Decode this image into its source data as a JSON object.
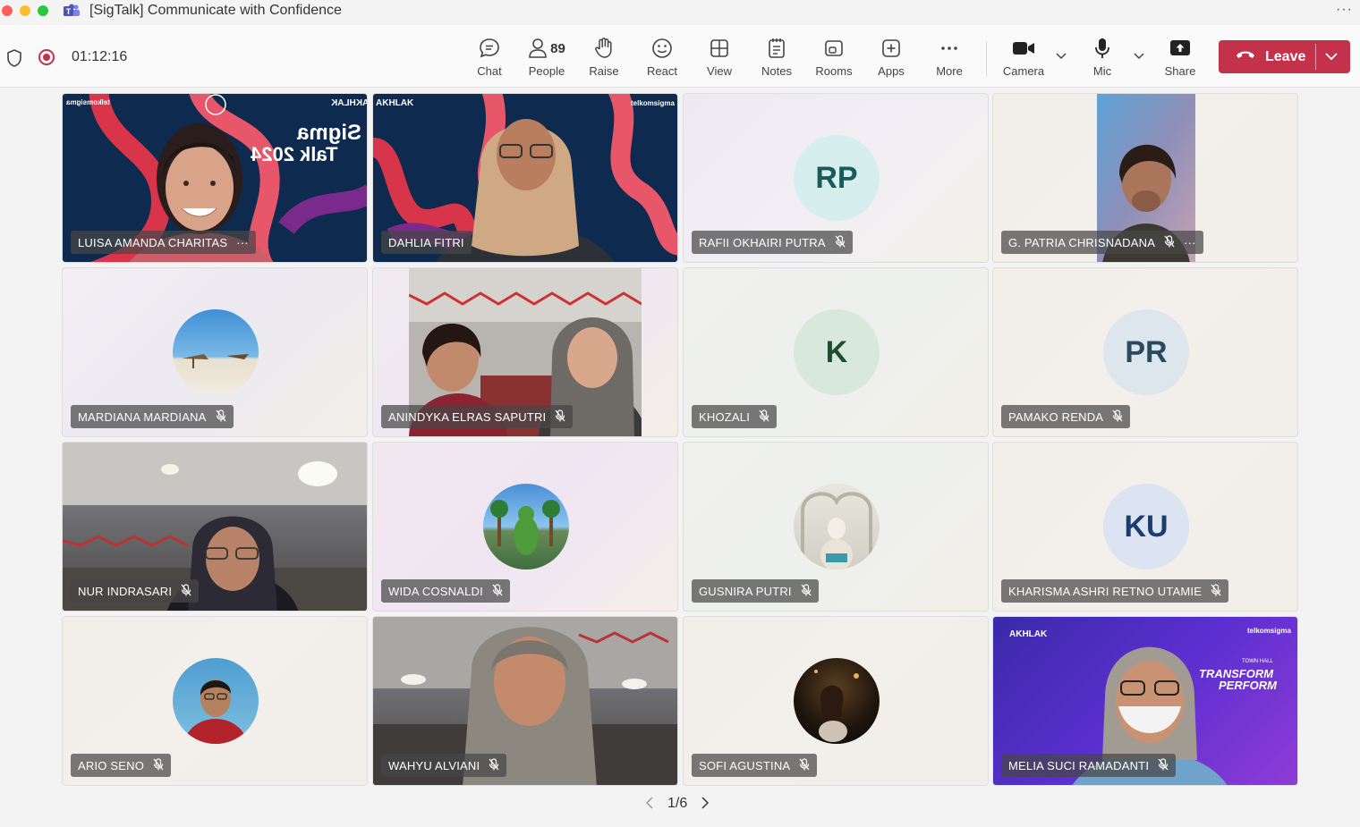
{
  "window": {
    "title": "[SigTalk] Communicate with Confidence"
  },
  "toolbar": {
    "timer": "01:12:16",
    "chat_label": "Chat",
    "people_label": "People",
    "people_count": "89",
    "raise_label": "Raise",
    "react_label": "React",
    "view_label": "View",
    "notes_label": "Notes",
    "rooms_label": "Rooms",
    "apps_label": "Apps",
    "more_label": "More",
    "camera_label": "Camera",
    "mic_label": "Mic",
    "share_label": "Share",
    "leave_label": "Leave"
  },
  "colors": {
    "leave": "#c4314b",
    "recording": "#c4314b"
  },
  "participants": [
    {
      "name": "LUISA AMANDA CHARITAS",
      "type": "video",
      "muted": false,
      "more": true
    },
    {
      "name": "DAHLIA FITRI",
      "type": "video",
      "muted": false
    },
    {
      "name": "RAFII OKHAIRI PUTRA",
      "type": "initials",
      "initials": "RP",
      "muted": true
    },
    {
      "name": "G. PATRIA CHRISNADANA",
      "type": "video",
      "muted": true,
      "more": true
    },
    {
      "name": "MARDIANA MARDIANA",
      "type": "photo",
      "muted": true
    },
    {
      "name": "ANINDYKA ELRAS SAPUTRI",
      "type": "video",
      "muted": true
    },
    {
      "name": "KHOZALI",
      "type": "initials",
      "initials": "K",
      "muted": true
    },
    {
      "name": "PAMAKO RENDA",
      "type": "initials",
      "initials": "PR",
      "muted": true
    },
    {
      "name": "NUR INDRASARI",
      "type": "video",
      "muted": true
    },
    {
      "name": "WIDA COSNALDI",
      "type": "photo",
      "muted": true
    },
    {
      "name": "GUSNIRA PUTRI",
      "type": "photo",
      "muted": true
    },
    {
      "name": "KHARISMA ASHRI RETNO UTAMIE",
      "type": "initials",
      "initials": "KU",
      "muted": true
    },
    {
      "name": "ARIO SENO",
      "type": "photo",
      "muted": true
    },
    {
      "name": "WAHYU ALVIANI",
      "type": "video",
      "muted": true
    },
    {
      "name": "SOFI AGUSTINA",
      "type": "photo",
      "muted": true
    },
    {
      "name": "MELIA SUCI RAMADANTI",
      "type": "video",
      "muted": true
    }
  ],
  "backgrounds": {
    "sigma_logo": "telkomsigma",
    "akhlak": "AKHLAK",
    "sigma_talk_line1": "Sigma",
    "sigma_talk_line2": "Talk 2024",
    "transform_line1": "TRANSFORM",
    "transform_line2": "PERFORM",
    "town_hall": "TOWN HALL"
  },
  "pager": {
    "text": "1/6"
  }
}
